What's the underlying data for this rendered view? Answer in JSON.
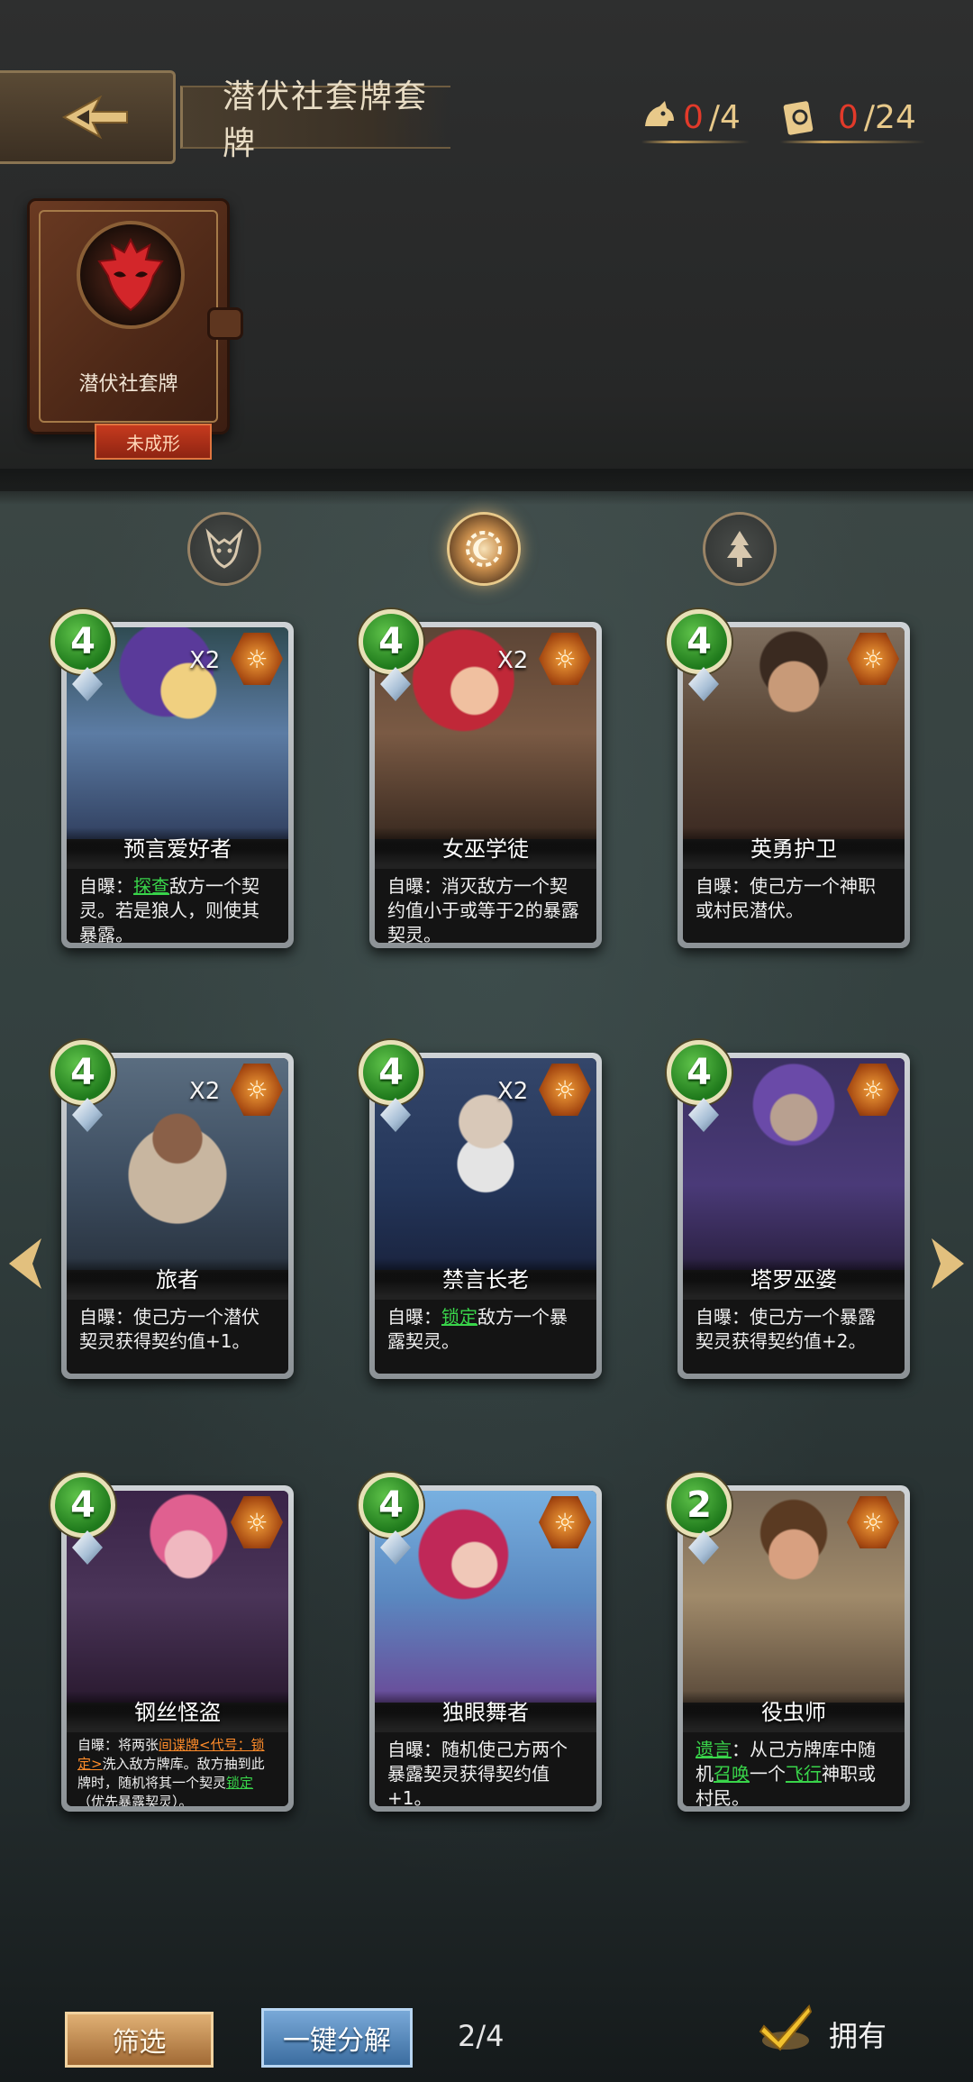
{
  "header": {
    "title": "潜伏社套牌套牌",
    "counter_left": {
      "current": "0",
      "max": "/4",
      "icon": "wolf-icon"
    },
    "counter_right": {
      "current": "0",
      "max": " /24",
      "icon": "card-icon"
    }
  },
  "deck": {
    "name": "潜伏社套牌",
    "status": "未成形",
    "emblem": "red-mask-icon"
  },
  "filters": [
    {
      "icon": "wolf-icon",
      "active": false
    },
    {
      "icon": "sun-moon-icon",
      "active": true
    },
    {
      "icon": "tree-icon",
      "active": false
    }
  ],
  "cards": [
    {
      "cost": "4",
      "count": "X2",
      "name": "预言爱好者",
      "desc_pre": "自曝：",
      "kw": "探查",
      "desc_post": "敌方一个契灵。若是狼人，则使其暴露。"
    },
    {
      "cost": "4",
      "count": "X2",
      "name": "女巫学徒",
      "desc_pre": "自曝：消灭敌方一个契约值小于或等于2的暴露契灵。",
      "kw": "",
      "desc_post": ""
    },
    {
      "cost": "4",
      "count": "",
      "name": "英勇护卫",
      "desc_pre": "自曝：使己方一个神职或村民潜伏。",
      "kw": "",
      "desc_post": ""
    },
    {
      "cost": "4",
      "count": "X2",
      "name": "旅者",
      "desc_pre": "自曝：使己方一个潜伏契灵获得契约值+1。",
      "kw": "",
      "desc_post": ""
    },
    {
      "cost": "4",
      "count": "X2",
      "name": "禁言长老",
      "desc_pre": "自曝：",
      "kw": "锁定",
      "desc_post": "敌方一个暴露契灵。"
    },
    {
      "cost": "4",
      "count": "",
      "name": "塔罗巫婆",
      "desc_pre": "自曝：使己方一个暴露契灵获得契约值+2。",
      "kw": "",
      "desc_post": ""
    },
    {
      "cost": "4",
      "count": "",
      "name": "钢丝怪盗",
      "desc_pre": "自曝：将两张",
      "kw": "间谍牌<代号：锁定>",
      "desc_post": "洗入敌方牌库。敌方抽到此牌时，随机将其一个契灵",
      "kw2": "锁定",
      "desc_post2": "（优先暴露契灵）。"
    },
    {
      "cost": "4",
      "count": "",
      "name": "独眼舞者",
      "desc_pre": "自曝：随机使己方两个暴露契灵获得契约值+1。",
      "kw": "",
      "desc_post": ""
    },
    {
      "cost": "2",
      "count": "",
      "name": "役虫师",
      "desc_pre": "",
      "kw": "遗言",
      "desc_post": "：从己方牌库中随机",
      "kw2": "召唤",
      "desc_post2": "一个",
      "kw3": "飞行",
      "desc_post3": "神职或村民。"
    }
  ],
  "bottom": {
    "filter_label": "筛选",
    "decompose_label": "一键分解",
    "page": "2/4",
    "owned_label": "拥有"
  },
  "colors": {
    "cost_green": "#1f7a1c",
    "faction_orange": "#a74a12",
    "keyword_green": "#39d44a",
    "counter_red": "#e23a2a"
  }
}
